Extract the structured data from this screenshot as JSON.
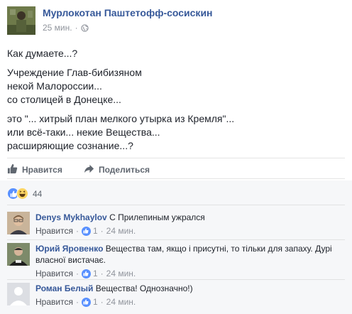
{
  "post": {
    "author": "Мурлокотан Паштетофф-сосискин",
    "time": "25 мин.",
    "audience_icon": "globe-icon",
    "paragraphs": [
      "Как думаете...?",
      "Учреждение Глав-бибизяном\nнекой Малороссии...\nсо столицей в Донецке...",
      "это \"... хитрый план мелкого утырка из Кремля\"...\nили всё-таки... некие Вещества...\nрасширяющие сознание...?"
    ]
  },
  "actions": {
    "like_label": "Нравится",
    "share_label": "Поделиться"
  },
  "reactions": {
    "count": "44",
    "icons": [
      "like-reaction-icon",
      "haha-reaction-icon"
    ]
  },
  "comments": [
    {
      "name": "Denys Mykhaylov",
      "text": "С Прилепиным ужрался",
      "like_label": "Нравится",
      "likes": "1",
      "time": "24 мин."
    },
    {
      "name": "Юрий Яровенко",
      "text": "Вещества там, якщо і присутні, то тільки для запаху. Дурі власної вистачає.",
      "like_label": "Нравится",
      "likes": "1",
      "time": "24 мин."
    },
    {
      "name": "Роман Белый",
      "text": "Вещества! Однозначно!)",
      "like_label": "Нравится",
      "likes": "1",
      "time": "24 мин."
    }
  ],
  "colors": {
    "link": "#365899",
    "text": "#1d2129",
    "meta": "#90949c",
    "like_blue": "#5890ff",
    "haha_yellow": "#fcd562",
    "comment_bg": "#f6f7f9"
  }
}
